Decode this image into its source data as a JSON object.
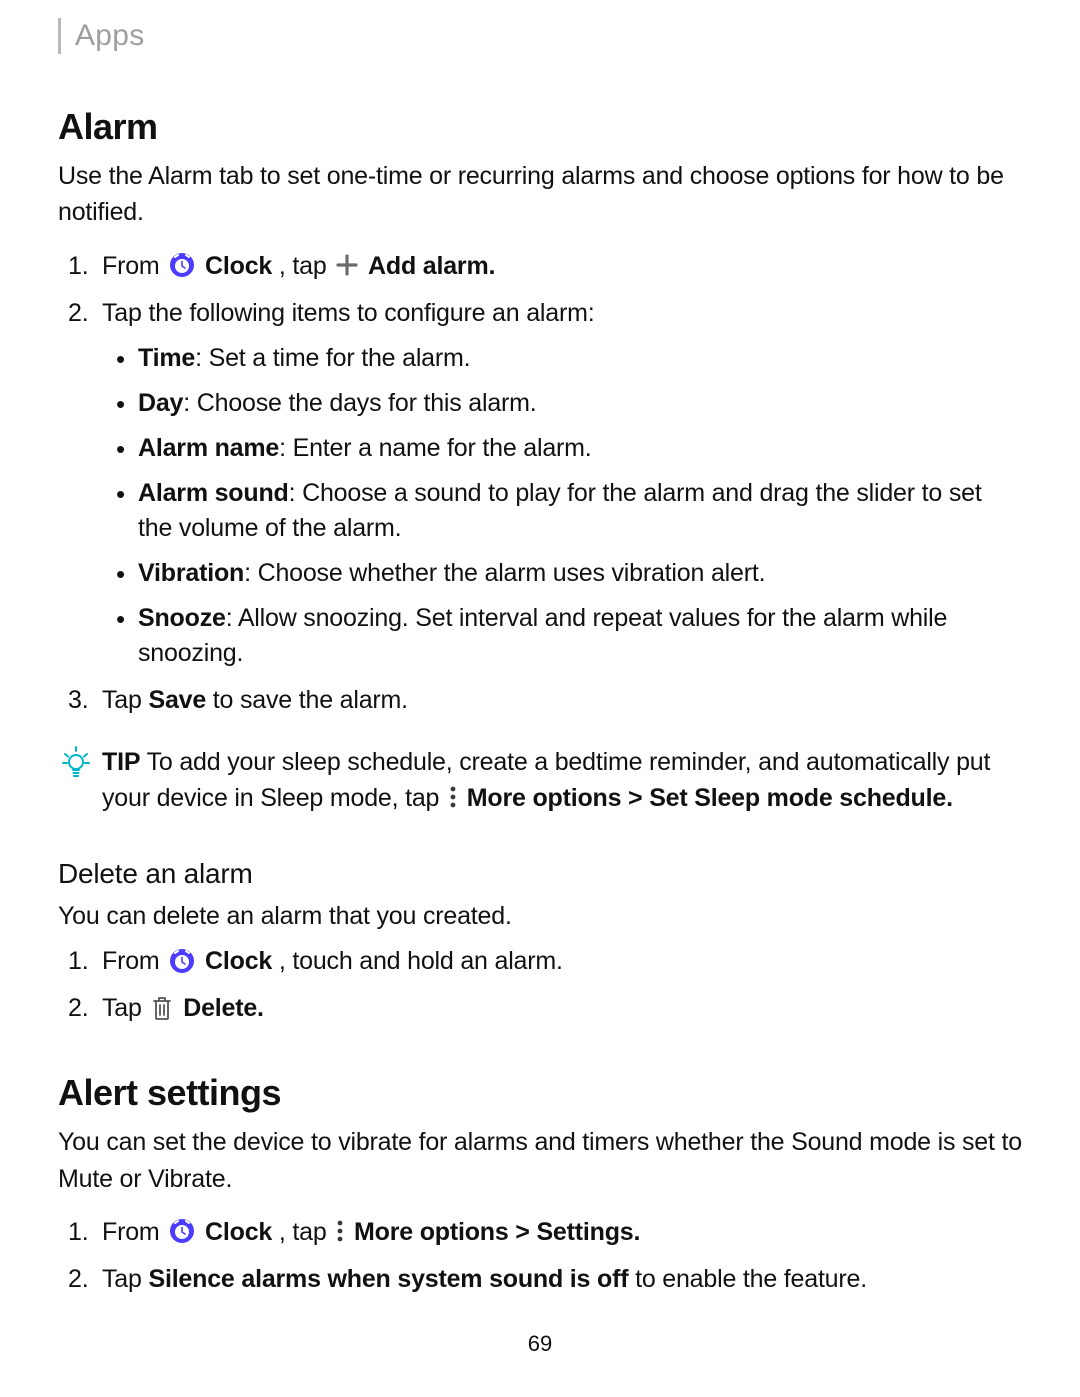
{
  "breadcrumb": "Apps",
  "alarm": {
    "heading": "Alarm",
    "intro": "Use the Alarm tab to set one-time or recurring alarms and choose options for how to be notified.",
    "step1": {
      "from": "From ",
      "clock": "Clock",
      "tap": ", tap ",
      "add": "Add alarm."
    },
    "step2": {
      "intro": "Tap the following items to configure an alarm:",
      "time_b": "Time",
      "time_t": ": Set a time for the alarm.",
      "day_b": "Day",
      "day_t": ": Choose the days for this alarm.",
      "name_b": "Alarm name",
      "name_t": ": Enter a name for the alarm.",
      "sound_b": "Alarm sound",
      "sound_t": ": Choose a sound to play for the alarm and drag the slider to set the volume of the alarm.",
      "vib_b": "Vibration",
      "vib_t": ": Choose whether the alarm uses vibration alert.",
      "snooze_b": "Snooze",
      "snooze_t": ": Allow snoozing. Set interval and repeat values for the alarm while snoozing."
    },
    "step3": {
      "pre": "Tap ",
      "save": "Save",
      "post": " to save the alarm."
    },
    "tip": {
      "label": "TIP",
      "pre": "  To add your sleep schedule, create a bedtime reminder, and automatically put your device in Sleep mode, tap ",
      "more": "More options > Set Sleep mode schedule."
    }
  },
  "delete": {
    "heading": "Delete an alarm",
    "intro": "You can delete an alarm that you created.",
    "step1": {
      "from": "From ",
      "clock": "Clock",
      "post": ", touch and hold an alarm."
    },
    "step2": {
      "pre": "Tap ",
      "del": "Delete."
    }
  },
  "alert": {
    "heading": "Alert settings",
    "intro": "You can set the device to vibrate for alarms and timers whether the Sound mode is set to Mute or Vibrate.",
    "step1": {
      "from": "From ",
      "clock": "Clock",
      "tap": ", tap ",
      "more": "More options > Settings."
    },
    "step2": {
      "pre": "Tap ",
      "bold": "Silence alarms when system sound is off",
      "post": " to enable the feature."
    }
  },
  "page_number": "69",
  "colors": {
    "accent": "#4b3cff",
    "tip": "#00b6c6"
  }
}
